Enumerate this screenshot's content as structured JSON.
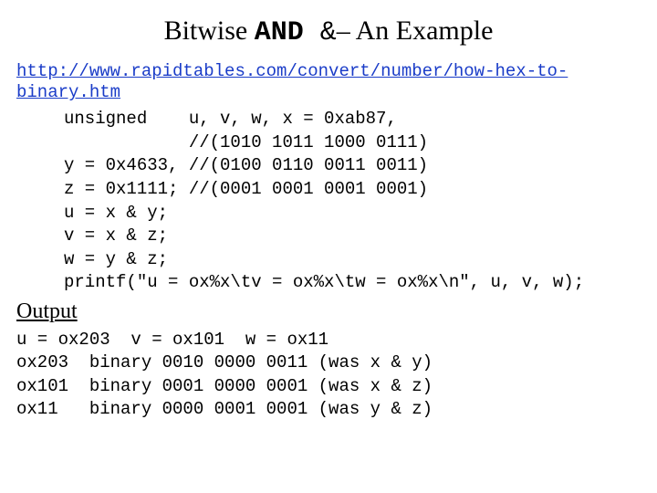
{
  "title": {
    "pre": "Bitwise ",
    "kw": "AND",
    "amp": " &",
    "post": "– An Example"
  },
  "link": "http://www.rapidtables.com/convert/number/how-hex-to-binary.htm",
  "code": "unsigned    u, v, w, x = 0xab87,\n            //(1010 1011 1000 0111)\ny = 0x4633, //(0100 0110 0011 0011)\nz = 0x1111; //(0001 0001 0001 0001)\nu = x & y;\nv = x & z;\nw = y & z;\nprintf(\"u = ox%x\\tv = ox%x\\tw = ox%x\\n\", u, v, w);",
  "output_label": "Output",
  "output": "u = ox203  v = ox101  w = ox11\nox203  binary 0010 0000 0011 (was x & y)\nox101  binary 0001 0000 0001 (was x & z)\nox11   binary 0000 0001 0001 (was y & z)"
}
